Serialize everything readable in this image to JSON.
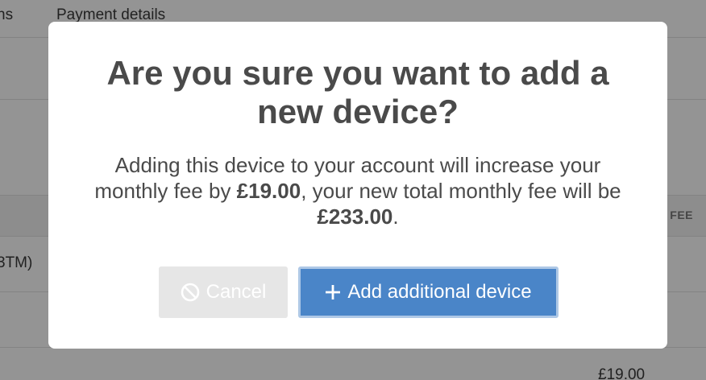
{
  "background": {
    "nav": {
      "left_item": "ns",
      "right_item": "Payment details"
    },
    "table": {
      "fee_header": "FEE",
      "row_partial_text": "3TM)",
      "price_partial": "£19.00"
    }
  },
  "modal": {
    "title": "Are you sure you want to add a new device?",
    "body": {
      "part1": "Adding this device to your account will increase your monthly fee by ",
      "fee_increase": "£19.00",
      "part2": ", your new total monthly fee will be ",
      "new_total": "£233.00",
      "part3": "."
    },
    "buttons": {
      "cancel_label": "Cancel",
      "cancel_icon": "ban-icon",
      "add_label": "Add additional device",
      "add_icon": "plus-icon"
    }
  },
  "colors": {
    "primary": "#4a85c8",
    "primary_focus_ring": "#aec8e6",
    "disabled": "#e6e6e6",
    "text": "#4a4a4a"
  }
}
